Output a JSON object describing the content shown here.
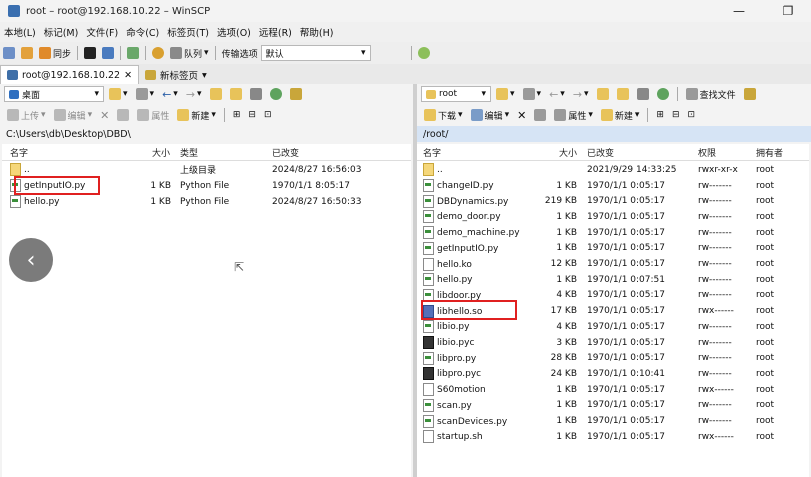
{
  "window": {
    "title": "root – root@192.168.10.22 – WinSCP",
    "minimize": "—",
    "restore": "❐"
  },
  "menu": [
    "本地(L)",
    "标记(M)",
    "文件(F)",
    "命令(C)",
    "标签页(T)",
    "选项(O)",
    "远程(R)",
    "帮助(H)"
  ],
  "toolbar": {
    "sync": "同步",
    "queue": "队列",
    "transfer_label": "传输选项",
    "transfer_value": "默认"
  },
  "tabs": [
    {
      "label": "root@192.168.10.22"
    },
    {
      "label": "新标签页"
    }
  ],
  "left": {
    "location": "桌面",
    "actions": {
      "upload": "上传",
      "edit": "编辑",
      "properties": "属性",
      "new": "新建"
    },
    "path": "C:\\Users\\db\\Desktop\\DBD\\",
    "columns": {
      "name": "名字",
      "size": "大小",
      "type": "类型",
      "changed": "已改变"
    },
    "rows": [
      {
        "name": "..",
        "size": "",
        "type": "上级目录",
        "changed": "2024/8/27 16:56:03",
        "icon": "up-folder-icon"
      },
      {
        "name": "getInputIO.py",
        "size": "1 KB",
        "type": "Python File",
        "changed": "1970/1/1 8:05:17",
        "icon": "python-file-icon"
      },
      {
        "name": "hello.py",
        "size": "1 KB",
        "type": "Python File",
        "changed": "2024/8/27 16:50:33",
        "icon": "python-file-icon"
      }
    ]
  },
  "right": {
    "location": "root",
    "find": "查找文件",
    "actions": {
      "download": "下载",
      "edit": "编辑",
      "properties": "属性",
      "new": "新建"
    },
    "path": "/root/",
    "columns": {
      "name": "名字",
      "size": "大小",
      "changed": "已改变",
      "rights": "权限",
      "owner": "拥有者"
    },
    "rows": [
      {
        "name": "..",
        "size": "",
        "changed": "2021/9/29 14:33:25",
        "rights": "rwxr-xr-x",
        "owner": "root",
        "icon": "up-folder-icon"
      },
      {
        "name": "changeID.py",
        "size": "1 KB",
        "changed": "1970/1/1 0:05:17",
        "rights": "rw-------",
        "owner": "root",
        "icon": "python-file-icon"
      },
      {
        "name": "DBDynamics.py",
        "size": "219 KB",
        "changed": "1970/1/1 0:05:17",
        "rights": "rw-------",
        "owner": "root",
        "icon": "python-file-icon"
      },
      {
        "name": "demo_door.py",
        "size": "1 KB",
        "changed": "1970/1/1 0:05:17",
        "rights": "rw-------",
        "owner": "root",
        "icon": "python-file-icon"
      },
      {
        "name": "demo_machine.py",
        "size": "1 KB",
        "changed": "1970/1/1 0:05:17",
        "rights": "rw-------",
        "owner": "root",
        "icon": "python-file-icon"
      },
      {
        "name": "getInputIO.py",
        "size": "1 KB",
        "changed": "1970/1/1 0:05:17",
        "rights": "rw-------",
        "owner": "root",
        "icon": "python-file-icon"
      },
      {
        "name": "hello.ko",
        "size": "12 KB",
        "changed": "1970/1/1 0:05:17",
        "rights": "rw-------",
        "owner": "root",
        "icon": "file-icon"
      },
      {
        "name": "hello.py",
        "size": "1 KB",
        "changed": "1970/1/1 0:07:51",
        "rights": "rw-------",
        "owner": "root",
        "icon": "python-file-icon"
      },
      {
        "name": "libdoor.py",
        "size": "4 KB",
        "changed": "1970/1/1 0:05:17",
        "rights": "rw-------",
        "owner": "root",
        "icon": "python-file-icon"
      },
      {
        "name": "libhello.so",
        "size": "17 KB",
        "changed": "1970/1/1 0:05:17",
        "rights": "rwx------",
        "owner": "root",
        "icon": "library-file-icon"
      },
      {
        "name": "libio.py",
        "size": "4 KB",
        "changed": "1970/1/1 0:05:17",
        "rights": "rw-------",
        "owner": "root",
        "icon": "python-file-icon"
      },
      {
        "name": "libio.pyc",
        "size": "3 KB",
        "changed": "1970/1/1 0:05:17",
        "rights": "rw-------",
        "owner": "root",
        "icon": "compiled-python-icon"
      },
      {
        "name": "libpro.py",
        "size": "28 KB",
        "changed": "1970/1/1 0:05:17",
        "rights": "rw-------",
        "owner": "root",
        "icon": "python-file-icon"
      },
      {
        "name": "libpro.pyc",
        "size": "24 KB",
        "changed": "1970/1/1 0:10:41",
        "rights": "rw-------",
        "owner": "root",
        "icon": "compiled-python-icon"
      },
      {
        "name": "S60motion",
        "size": "1 KB",
        "changed": "1970/1/1 0:05:17",
        "rights": "rwx------",
        "owner": "root",
        "icon": "file-icon"
      },
      {
        "name": "scan.py",
        "size": "1 KB",
        "changed": "1970/1/1 0:05:17",
        "rights": "rw-------",
        "owner": "root",
        "icon": "python-file-icon"
      },
      {
        "name": "scanDevices.py",
        "size": "1 KB",
        "changed": "1970/1/1 0:05:17",
        "rights": "rw-------",
        "owner": "root",
        "icon": "python-file-icon"
      },
      {
        "name": "startup.sh",
        "size": "1 KB",
        "changed": "1970/1/1 0:05:17",
        "rights": "rwx------",
        "owner": "root",
        "icon": "file-icon"
      }
    ]
  },
  "overlay": {
    "back": "‹"
  },
  "colors": {
    "highlight": "#e02020",
    "selected_pane": "#d6e4f5"
  }
}
